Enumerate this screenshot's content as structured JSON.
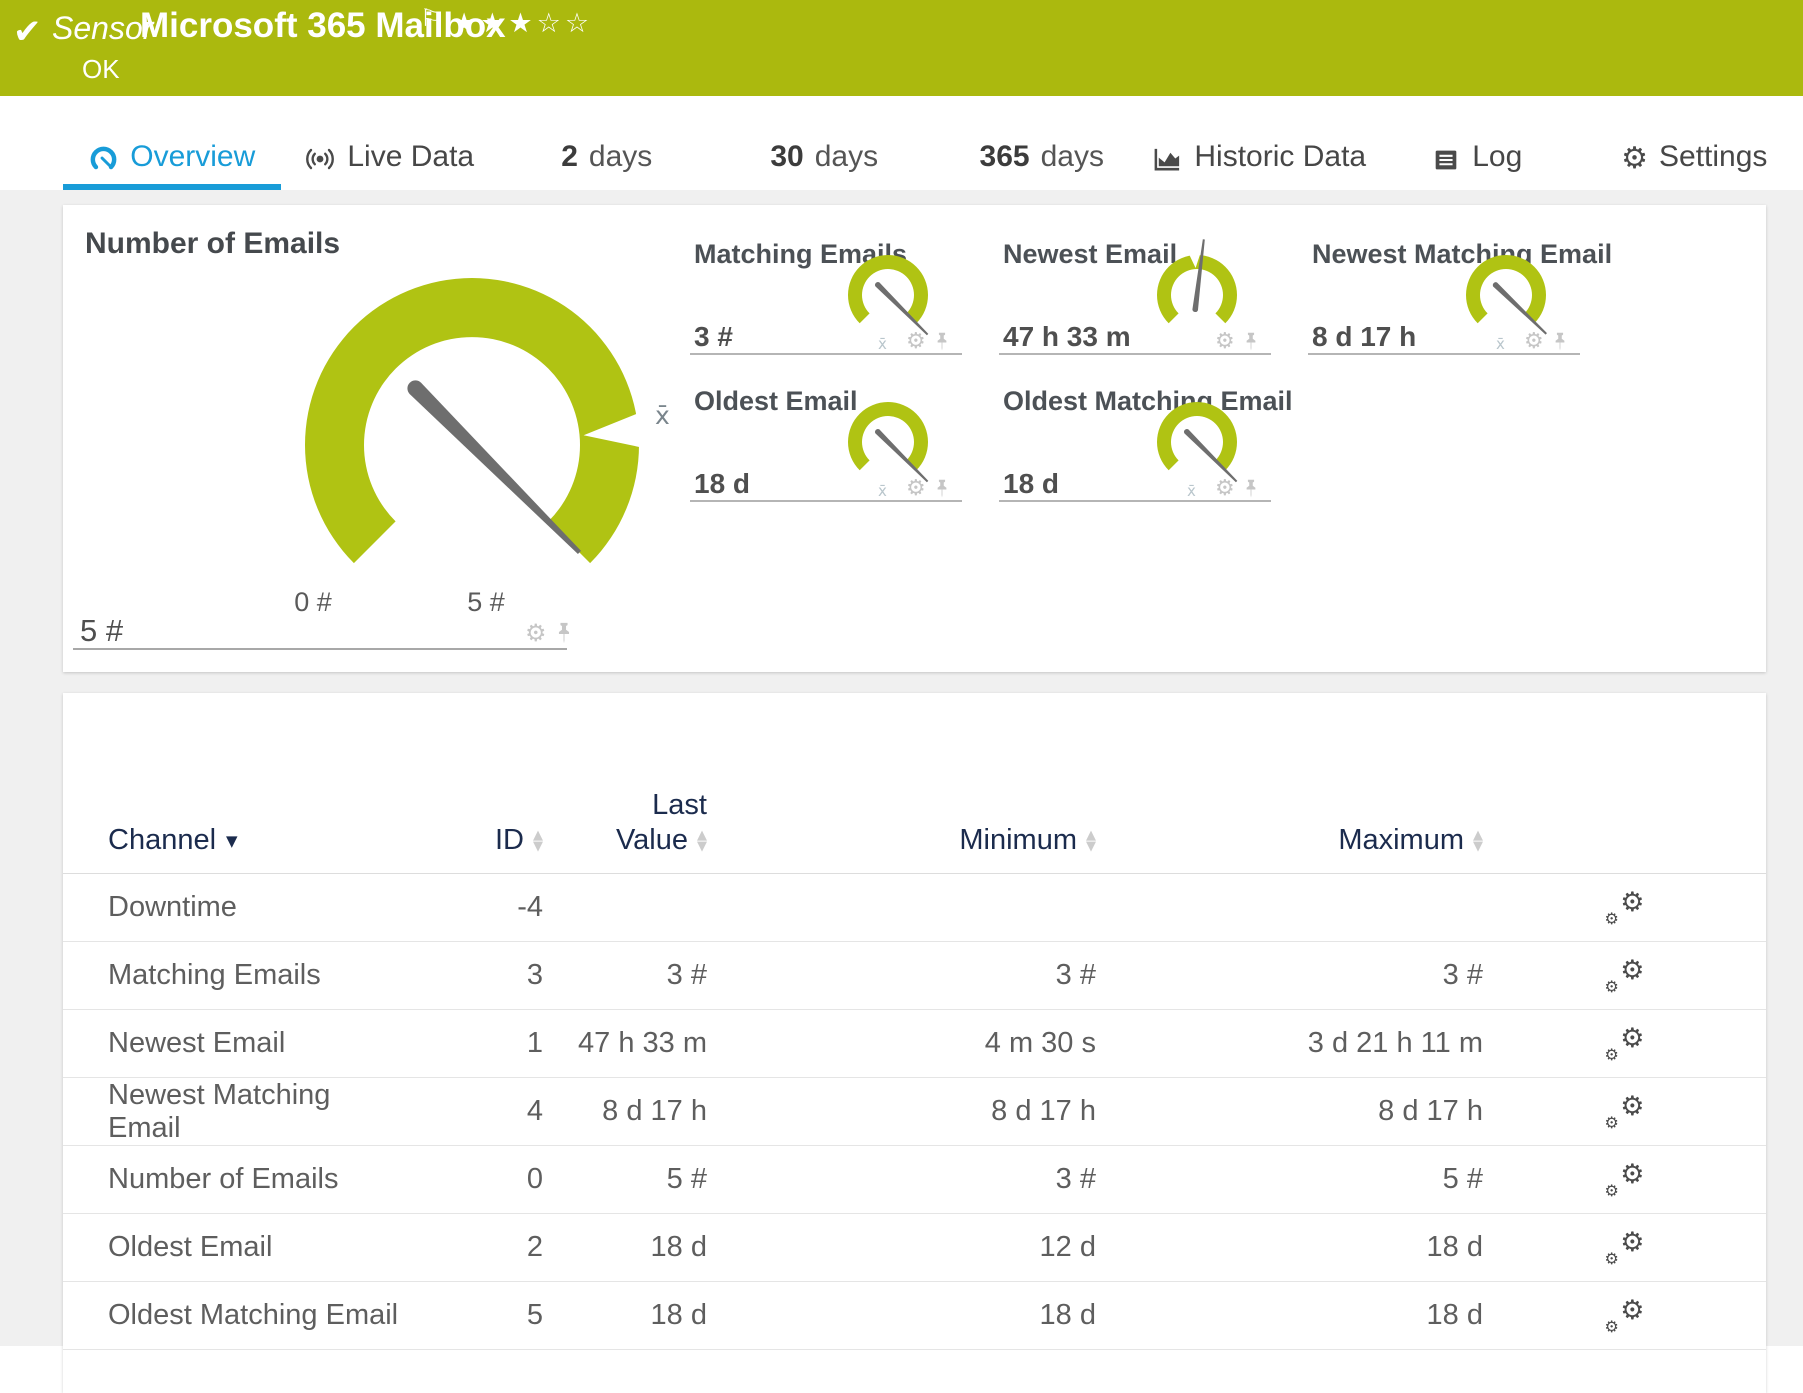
{
  "colors": {
    "brand_green": "#abb90e",
    "gauge_green": "#b0c313",
    "accent_blue": "#189cd8",
    "header_navy": "#1b2b4d",
    "needle_gray": "#6e6e6e",
    "text_gray": "#5e5e5e",
    "title_gray": "#45494d",
    "icon_light": "#c6c6c6",
    "icon_dark": "#4b4b4b",
    "page_bg": "#f0f0f0"
  },
  "icons": {
    "check": "✔",
    "flag": "⚐",
    "stars_filled": "★★★",
    "stars_empty": "☆☆",
    "gear": "⚙",
    "sort_asc": "▲",
    "sort_desc": "▼"
  },
  "header": {
    "kind_label": "Sensor",
    "title": "Microsoft 365 Mailbox",
    "status": "OK",
    "rating": "3 of 5 stars"
  },
  "tabs": [
    {
      "label": "Overview"
    },
    {
      "label": "Live Data"
    },
    {
      "number": "2",
      "unit": "days"
    },
    {
      "number": "30",
      "unit": "days"
    },
    {
      "number": "365",
      "unit": "days"
    },
    {
      "label": "Historic Data"
    },
    {
      "label": "Log"
    },
    {
      "label": "Settings"
    }
  ],
  "gauges": {
    "main": {
      "title": "Number of Emails",
      "value": "5 #",
      "min_label": "0 #",
      "max_label": "5 #",
      "needle_deg": 135,
      "mean_marker": "x̄"
    },
    "small": [
      {
        "title": "Matching Emails",
        "value": "3 #",
        "needle_deg": 135,
        "mean_marker": "x̄"
      },
      {
        "title": "Newest Email",
        "value": "47 h 33 m",
        "needle_deg": 7
      },
      {
        "title": "Newest Matching Email",
        "value": "8 d 17 h",
        "needle_deg": 134,
        "mean_marker": "x̄"
      },
      {
        "title": "Oldest Email",
        "value": "18 d",
        "needle_deg": 135,
        "mean_marker": "x̄"
      },
      {
        "title": "Oldest Matching Email",
        "value": "18 d",
        "needle_deg": 135,
        "mean_marker": "x̄"
      }
    ]
  },
  "table": {
    "header": {
      "channel": "Channel",
      "id": "ID",
      "last_line1": "Last",
      "last_line2": "Value",
      "min": "Minimum",
      "max": "Maximum"
    },
    "rows": [
      {
        "channel": "Downtime",
        "id": "-4",
        "last": "",
        "min": "",
        "max": ""
      },
      {
        "channel": "Matching Emails",
        "id": "3",
        "last": "3 #",
        "min": "3 #",
        "max": "3 #"
      },
      {
        "channel": "Newest Email",
        "id": "1",
        "last": "47 h 33 m",
        "min": "4 m 30 s",
        "max": "3 d 21 h 11 m"
      },
      {
        "channel": "Newest Matching Email",
        "id": "4",
        "last": "8 d 17 h",
        "min": "8 d 17 h",
        "max": "8 d 17 h"
      },
      {
        "channel": "Number of Emails",
        "id": "0",
        "last": "5 #",
        "min": "3 #",
        "max": "5 #"
      },
      {
        "channel": "Oldest Email",
        "id": "2",
        "last": "18 d",
        "min": "12 d",
        "max": "18 d"
      },
      {
        "channel": "Oldest Matching Email",
        "id": "5",
        "last": "18 d",
        "min": "18 d",
        "max": "18 d"
      }
    ]
  }
}
